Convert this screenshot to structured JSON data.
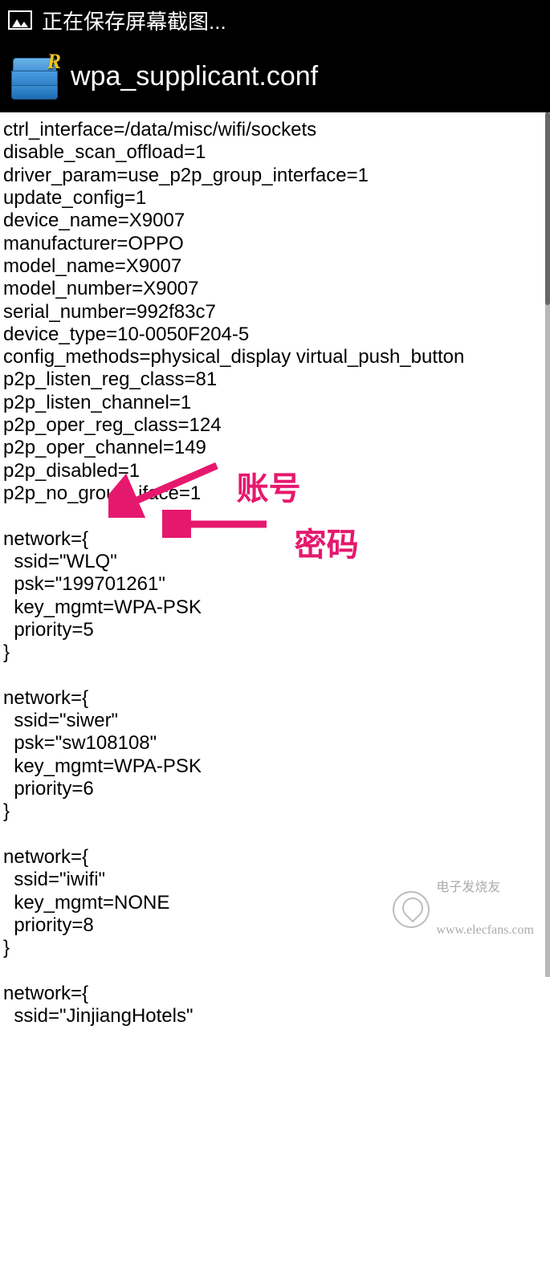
{
  "statusBar": {
    "savingText": "正在保存屏幕截图..."
  },
  "appBar": {
    "title": "wpa_supplicant.conf",
    "iconBadge": "R"
  },
  "fileContent": {
    "header": [
      "ctrl_interface=/data/misc/wifi/sockets",
      "disable_scan_offload=1",
      "driver_param=use_p2p_group_interface=1",
      "update_config=1",
      "device_name=X9007",
      "manufacturer=OPPO",
      "model_name=X9007",
      "model_number=X9007",
      "serial_number=992f83c7",
      "device_type=10-0050F204-5",
      "config_methods=physical_display virtual_push_button",
      "p2p_listen_reg_class=81",
      "p2p_listen_channel=1",
      "p2p_oper_reg_class=124",
      "p2p_oper_channel=149",
      "p2p_disabled=1",
      "p2p_no_group_iface=1"
    ],
    "networks": [
      {
        "ssid": "WLQ",
        "psk": "199701261",
        "key_mgmt": "WPA-PSK",
        "priority": 5
      },
      {
        "ssid": "siwer",
        "psk": "sw108108",
        "key_mgmt": "WPA-PSK",
        "priority": 6
      },
      {
        "ssid": "iwifi",
        "key_mgmt": "NONE",
        "priority": 8
      },
      {
        "ssid": "JinjiangHotels"
      }
    ]
  },
  "annotations": {
    "account": "账号",
    "password": "密码"
  },
  "watermark": {
    "line1": "电子发烧友",
    "line2": "www.elecfans.com"
  },
  "colors": {
    "annotationPink": "#e6186e",
    "appIconBlue": "#3d8fd6",
    "appIconGold": "#f5c518"
  }
}
